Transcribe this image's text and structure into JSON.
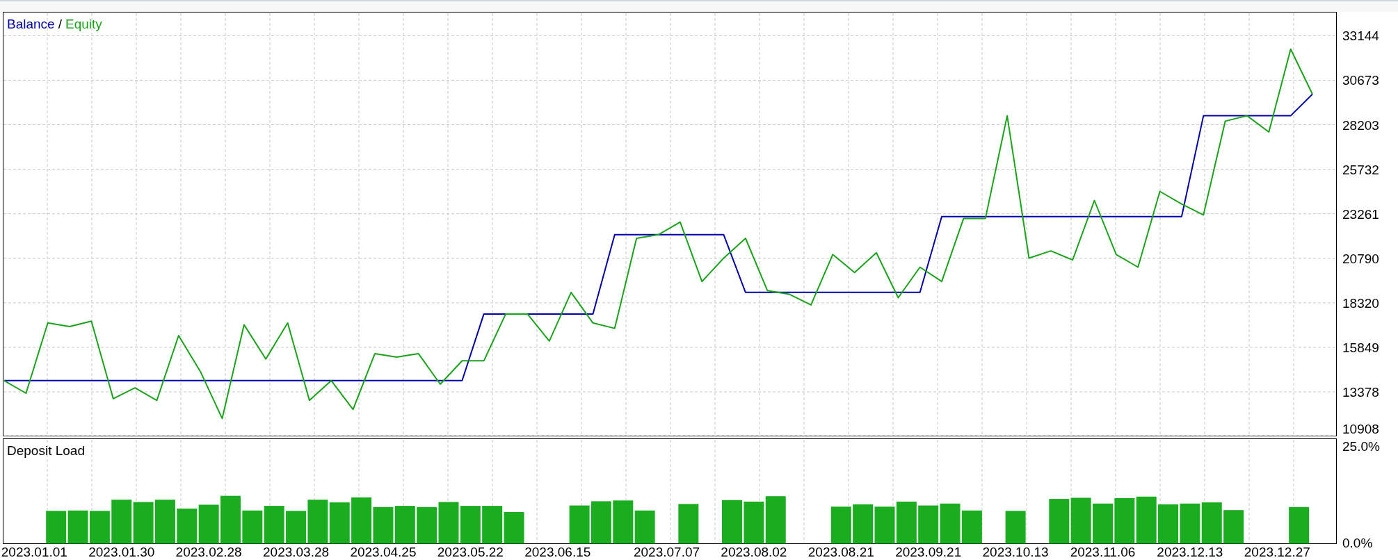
{
  "balance_equity_chart": {
    "legend_separator": "/",
    "chart_data": {
      "type": "line",
      "grid": true,
      "series": [
        {
          "name": "Balance",
          "color": "#0000a8",
          "values": [
            14000,
            14000,
            14000,
            14000,
            14000,
            14000,
            14000,
            14000,
            14000,
            14000,
            14000,
            14000,
            14000,
            14000,
            14000,
            14000,
            14000,
            14000,
            14000,
            14000,
            14000,
            14000,
            17700,
            17700,
            17700,
            17700,
            17700,
            17700,
            22100,
            22100,
            22100,
            22100,
            22100,
            22100,
            18900,
            18900,
            18900,
            18900,
            18900,
            18900,
            18900,
            18900,
            18900,
            23100,
            23100,
            23100,
            23100,
            23100,
            23100,
            23100,
            23100,
            23100,
            23100,
            23100,
            23100,
            28700,
            28700,
            28700,
            28700,
            28700,
            29900
          ]
        },
        {
          "name": "Equity",
          "color": "#1aa31a",
          "values": [
            14000,
            13300,
            17200,
            17000,
            17300,
            13000,
            13600,
            12900,
            16500,
            14500,
            11900,
            17100,
            15200,
            17200,
            12900,
            14000,
            12400,
            15500,
            15300,
            15500,
            13800,
            15100,
            15100,
            17700,
            17700,
            16200,
            18900,
            17200,
            16900,
            21900,
            22100,
            22800,
            19500,
            20800,
            21900,
            19000,
            18800,
            18200,
            21000,
            20000,
            21100,
            18600,
            20300,
            19500,
            23000,
            23000,
            28700,
            20800,
            21200,
            20700,
            24000,
            21000,
            20300,
            24500,
            23800,
            23200,
            28400,
            28700,
            27800,
            32400,
            29900
          ]
        }
      ],
      "ylim": [
        10908,
        34432
      ],
      "yticks": [
        10908,
        13378,
        15849,
        18320,
        20790,
        23261,
        25732,
        28203,
        30673,
        33144
      ]
    }
  },
  "deposit_load_chart": {
    "chart_data": {
      "type": "bar",
      "title": "Deposit Load",
      "grid": true,
      "categories": [
        null,
        "2023.01.01",
        null,
        null,
        null,
        "2023.01.30",
        null,
        null,
        null,
        "2023.02.28",
        null,
        null,
        null,
        "2023.03.28",
        null,
        null,
        null,
        "2023.04.25",
        null,
        null,
        null,
        "2023.05.22",
        null,
        null,
        null,
        "2023.06.15",
        null,
        null,
        null,
        null,
        "2023.07.07",
        null,
        null,
        null,
        "2023.08.02",
        null,
        null,
        null,
        "2023.08.21",
        null,
        null,
        null,
        "2023.09.21",
        null,
        null,
        null,
        "2023.10.13",
        null,
        null,
        null,
        "2023.11.06",
        null,
        null,
        null,
        "2023.12.13",
        null,
        null,
        null,
        "2023.12.27",
        null,
        null
      ],
      "series": [
        {
          "color": "#1aad1f",
          "values": [
            null,
            null,
            8.5,
            8.6,
            8.5,
            11.4,
            10.8,
            11.4,
            9.1,
            10.1,
            12.4,
            8.6,
            9.8,
            8.5,
            11.4,
            10.7,
            12.0,
            9.5,
            9.8,
            9.5,
            10.8,
            9.8,
            9.8,
            8.2,
            null,
            null,
            9.9,
            11.0,
            11.2,
            8.6,
            null,
            10.3,
            null,
            11.3,
            10.9,
            12.3,
            null,
            null,
            9.6,
            10.2,
            9.6,
            10.9,
            9.9,
            10.4,
            8.6,
            null,
            8.5,
            null,
            11.6,
            11.9,
            10.4,
            11.8,
            12.2,
            10.2,
            10.4,
            10.7,
            8.7,
            null,
            null,
            9.5,
            null
          ]
        }
      ],
      "ylim": [
        0,
        27.2
      ],
      "yticks": [
        {
          "value": 0,
          "label": "0.0%"
        },
        {
          "value": 25,
          "label": "25.0%"
        }
      ]
    }
  }
}
